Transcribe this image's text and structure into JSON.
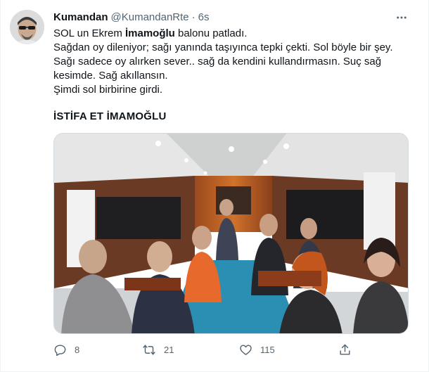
{
  "tweet": {
    "display_name": "Kumandan",
    "handle": "@KumandanRte",
    "separator": "·",
    "time": "6s",
    "lines": [
      "SOL un Ekrem İmamoğlu balonu patladı.",
      "Sağdan oy dileniyor; sağı yanında taşıyınca tepki çekti. Sol böyle bir şey.",
      "Sağı sadece oy alırken sever.. sağ da kendini kullandırmasın. Suç sağ",
      "kesimde. Sağ akıllansın.",
      "Şimdi sol birbirine girdi."
    ],
    "line1_pre": "SOL un Ekrem ",
    "line1_bold": "İmamoğlu",
    "line1_post": " balonu patladı.",
    "headline": "İSTİFA ET İMAMOĞLU"
  },
  "actions": {
    "reply": {
      "icon": "reply-icon",
      "count": "8"
    },
    "retweet": {
      "icon": "retweet-icon",
      "count": "21"
    },
    "like": {
      "icon": "heart-icon",
      "count": "115"
    },
    "share": {
      "icon": "share-icon"
    }
  },
  "colors": {
    "text": "#0f1419",
    "secondary": "#536471",
    "border": "#cfd9de"
  }
}
